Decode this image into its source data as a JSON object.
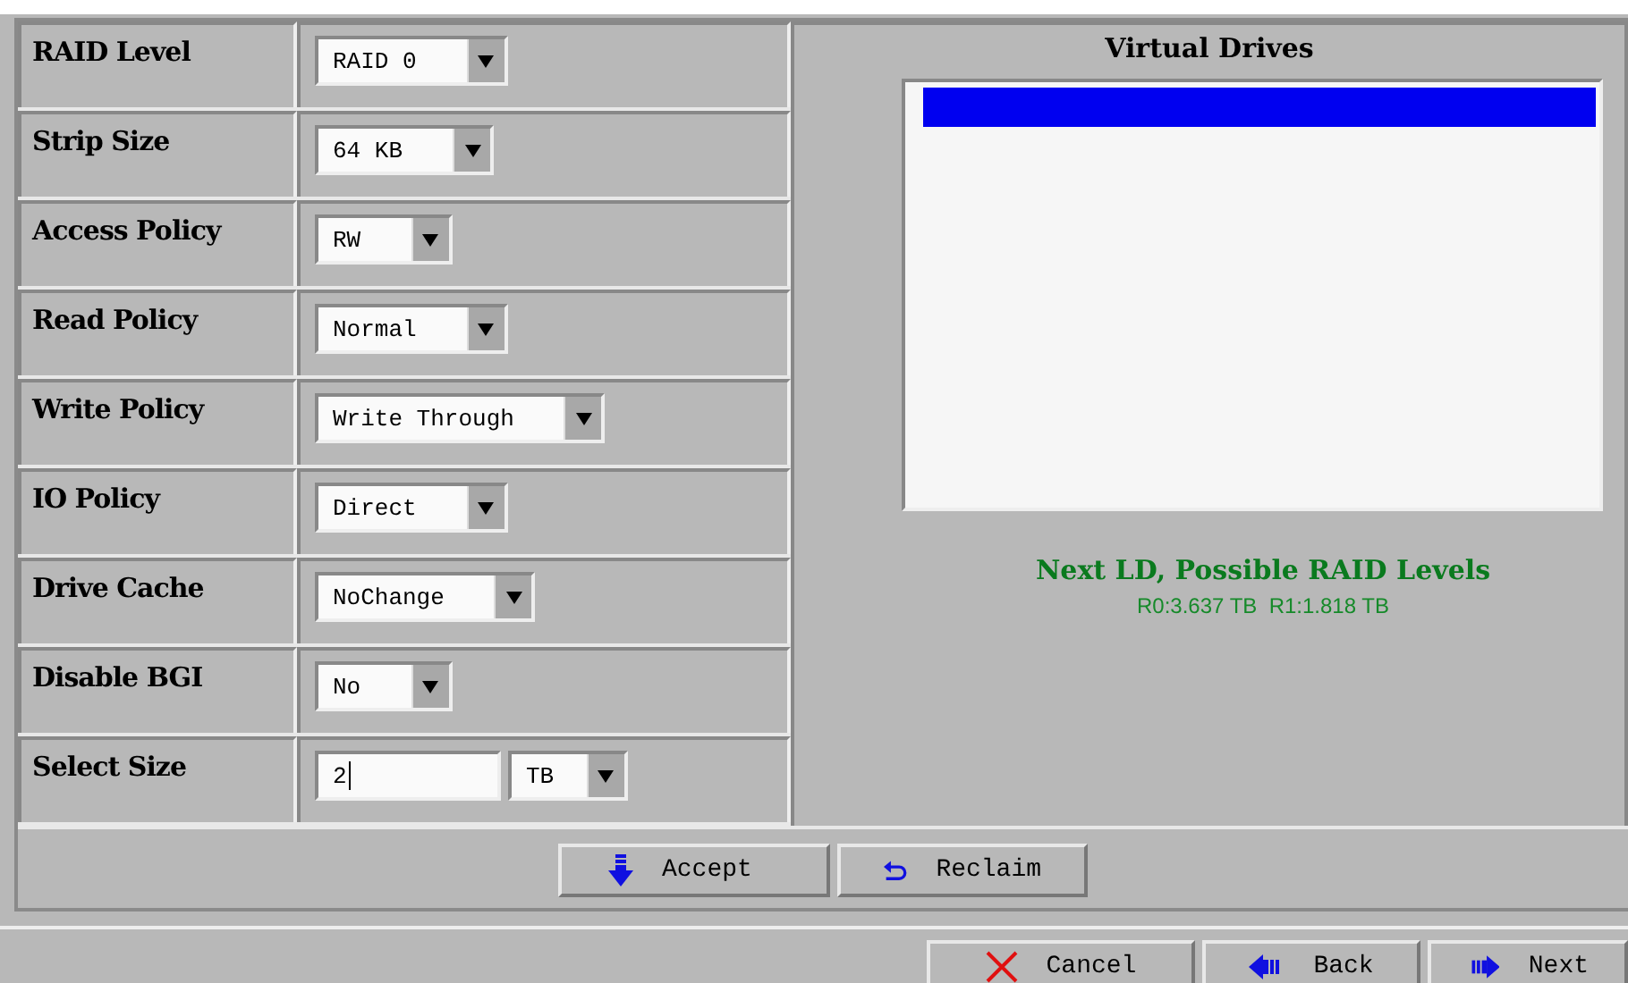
{
  "settings": [
    {
      "label": "RAID Level",
      "kind": "dropdown",
      "value": "RAID 0"
    },
    {
      "label": "Strip Size",
      "kind": "dropdown",
      "value": "64 KB"
    },
    {
      "label": "Access Policy",
      "kind": "dropdown",
      "value": "RW"
    },
    {
      "label": "Read Policy",
      "kind": "dropdown",
      "value": "Normal"
    },
    {
      "label": "Write Policy",
      "kind": "dropdown",
      "value": "Write Through"
    },
    {
      "label": "IO Policy",
      "kind": "dropdown",
      "value": "Direct"
    },
    {
      "label": "Drive Cache",
      "kind": "dropdown",
      "value": "NoChange"
    },
    {
      "label": "Disable BGI",
      "kind": "dropdown",
      "value": "No"
    },
    {
      "label": "Select Size",
      "kind": "size",
      "value": "2",
      "unit": "TB"
    }
  ],
  "virtual_drives": {
    "title": "Virtual Drives",
    "items": [
      {
        "selected": true
      }
    ]
  },
  "next_ld": {
    "heading": "Next LD, Possible RAID Levels",
    "levels": "R0:3.637 TB  R1:1.818 TB"
  },
  "actions": [
    {
      "label": "Accept",
      "kind": "accept"
    },
    {
      "label": "Reclaim",
      "kind": "reclaim"
    }
  ],
  "nav_buttons": [
    {
      "label": "Cancel",
      "kind": "cancel"
    },
    {
      "label": "Back",
      "kind": "back"
    },
    {
      "label": "Next",
      "kind": "next"
    }
  ]
}
